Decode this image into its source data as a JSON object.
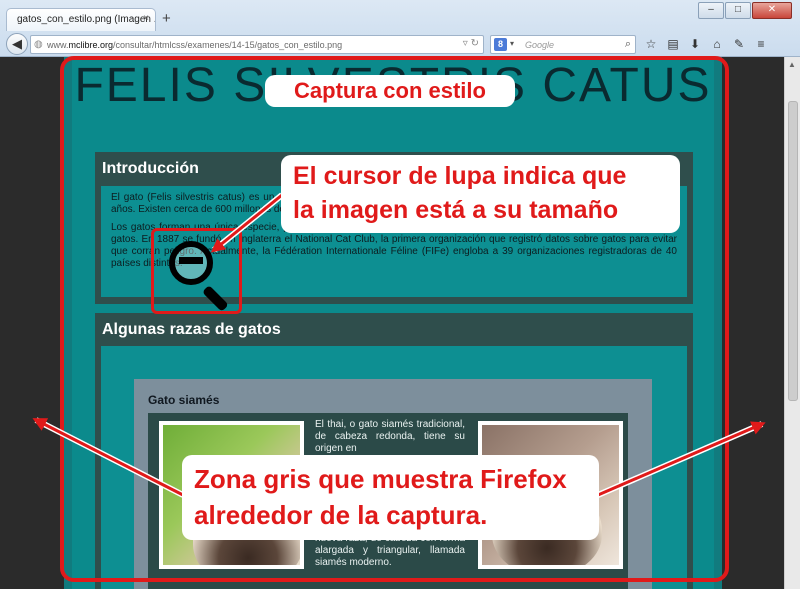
{
  "browser": {
    "tab_title": "gatos_con_estilo.png (Imagen ...",
    "tab_close": "×",
    "new_tab": "+",
    "window_buttons": {
      "minimize": "–",
      "maximize": "□",
      "close": "✕"
    },
    "url": {
      "prefix": "www.",
      "host": "mclibre.org",
      "path": "/consultar/htmlcss/examenes/14-15/gatos_con_estilo.png"
    },
    "search": {
      "engine_letter": "8",
      "placeholder": "Google"
    }
  },
  "captured_page": {
    "heading": "FELIS SILVESTRIS CATUS",
    "intro": {
      "title": "Introducción",
      "paragraph_1": "El gato (Felis silvestris catus) es un animal doméstico que lleva conviviendo con el ser humano al menos desde hace 9500 años. Existen cerca de 600 millones de gatos domésticos en contraposición a los gatos salvajes o domésticos.",
      "paragraph_2": "Los gatos forman una única especie, pero cruzando gatos de características físicas similares se han ido creando \"razas\" de gatos. En 1887 se fundó en Inglaterra el National Cat Club, la primera organización que registró datos sobre gatos para evitar que corran peligro. Actualmente, la Fédération Internationale Féline (FIFe) engloba a 39 organizaciones registradoras de 40 países distintos."
    },
    "razas": {
      "title": "Algunas razas de gatos",
      "card": {
        "title": "Gato siamés",
        "text_top": "El thai, o gato siamés tradicional, de cabeza redonda, tiene su origen en",
        "text_bottom": "nueva raza, de cabeza con forma alargada y triangular, llamada siamés moderno."
      }
    }
  },
  "annotations": {
    "title": "Captura con estilo",
    "cursor_line_1": "El cursor de lupa indica que",
    "cursor_line_2": "la imagen está a su tamaño",
    "zone_line_1": "Zona gris que muestra Firefox",
    "zone_line_2": "alrededor de la captura."
  },
  "colors": {
    "annotation_red": "#e01a1a",
    "viewport_gray": "#2b2b2b",
    "page_teal": "#0b8a8c",
    "section_dark": "#2f4e4c"
  },
  "icons": [
    "back-arrow-icon",
    "globe-icon",
    "reload-icon",
    "search-engine-icon",
    "search-icon",
    "bookmark-star-icon",
    "clipboard-icon",
    "download-icon",
    "home-icon",
    "paint-icon",
    "menu-icon",
    "magnifier-zoom-out-icon"
  ]
}
